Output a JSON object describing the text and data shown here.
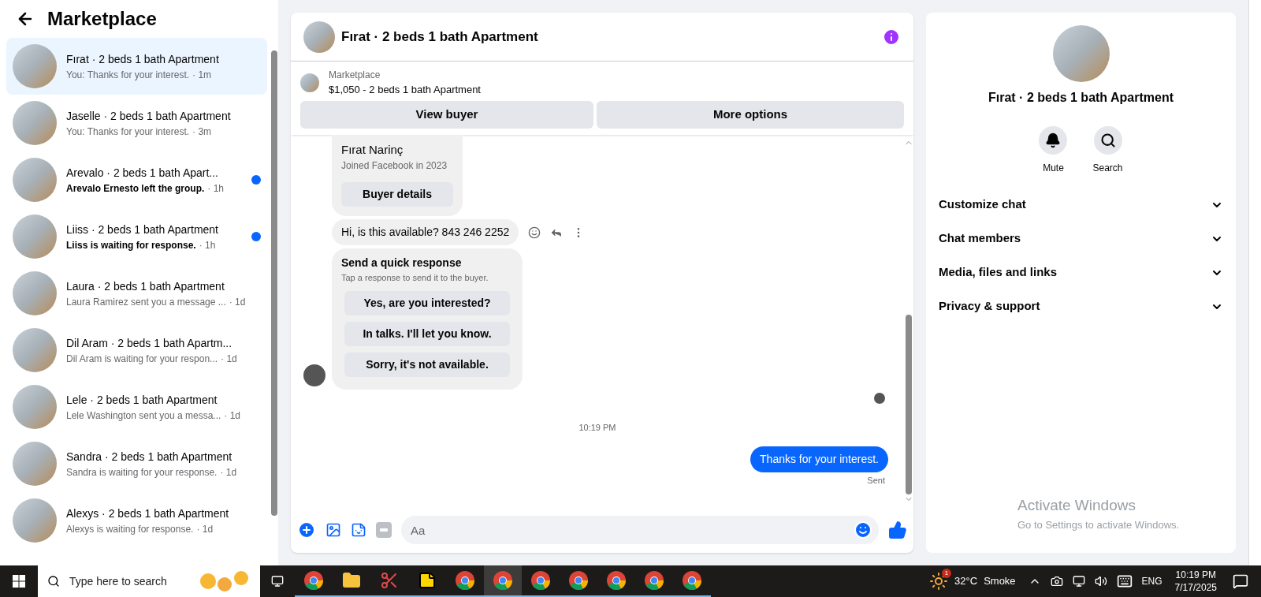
{
  "sidebar": {
    "title": "Marketplace",
    "conversations": [
      {
        "title": "Fırat · 2 beds 1 bath Apartment",
        "preview": "You: Thanks for your interest.",
        "time": "· 1m",
        "unread": false,
        "selected": true
      },
      {
        "title": "Jaselle · 2 beds 1 bath Apartment",
        "preview": "You: Thanks for your interest.",
        "time": "· 3m",
        "unread": false,
        "selected": false
      },
      {
        "title": "Arevalo · 2 beds 1 bath Apart...",
        "preview": "Arevalo Ernesto left the group.",
        "time": "· 1h",
        "unread": true,
        "selected": false
      },
      {
        "title": "Liiss · 2 beds 1 bath Apartment",
        "preview": "Liiss is waiting for response.",
        "time": "· 1h",
        "unread": true,
        "selected": false
      },
      {
        "title": "Laura · 2 beds 1 bath Apartment",
        "preview": "Laura Ramirez sent you a message ...",
        "time": "· 1d",
        "unread": false,
        "selected": false
      },
      {
        "title": "Dil Aram · 2 beds 1 bath Apartm...",
        "preview": "Dil Aram is waiting for your respon...",
        "time": "· 1d",
        "unread": false,
        "selected": false
      },
      {
        "title": "Lele · 2 beds 1 bath Apartment",
        "preview": "Lele Washington sent you a messa...",
        "time": "· 1d",
        "unread": false,
        "selected": false
      },
      {
        "title": "Sandra · 2 beds 1 bath Apartment",
        "preview": "Sandra is waiting for your response.",
        "time": "· 1d",
        "unread": false,
        "selected": false
      },
      {
        "title": "Alexys · 2 beds 1 bath Apartment",
        "preview": "Alexys is waiting for response.",
        "time": "· 1d",
        "unread": false,
        "selected": false
      }
    ]
  },
  "chat": {
    "title": "Fırat · 2 beds 1 bath Apartment",
    "listing": {
      "label": "Marketplace",
      "title": "$1,050 - 2 beds 1 bath Apartment",
      "buttons": [
        "View buyer",
        "More options"
      ]
    },
    "buyer_card": {
      "name": "Fırat Narinç",
      "subtitle": "Joined Facebook in 2023",
      "button": "Buyer details"
    },
    "incoming_message": "Hi, is this available? 843 246 2252",
    "quick_response": {
      "title": "Send a quick response",
      "subtitle": "Tap a response to send it to the buyer.",
      "options": [
        "Yes, are you interested?",
        "In talks. I'll let you know.",
        "Sorry, it's not available."
      ]
    },
    "timestamp": "10:19 PM",
    "outgoing_message": "Thanks for your interest.",
    "status": "Sent",
    "composer": {
      "placeholder": "Aa"
    }
  },
  "details": {
    "title": "Fırat · 2 beds 1 bath Apartment",
    "actions": [
      {
        "kind": "mute",
        "label": "Mute"
      },
      {
        "kind": "search",
        "label": "Search"
      }
    ],
    "sections": [
      {
        "label": "Customize chat",
        "expanded": false
      },
      {
        "label": "Chat members",
        "expanded": false
      },
      {
        "label": "Media, files and links",
        "expanded": false
      },
      {
        "label": "Privacy & support",
        "expanded": false
      }
    ]
  },
  "activation_notice": {
    "title": "Activate Windows",
    "text": "Go to Settings to activate Windows."
  },
  "taskbar": {
    "search_placeholder": "Type here to search",
    "apps": [
      {
        "kind": "browser",
        "selected": false
      },
      {
        "kind": "folder",
        "selected": false
      },
      {
        "kind": "snip",
        "selected": false
      },
      {
        "kind": "note",
        "selected": false
      },
      {
        "kind": "browser",
        "selected": false
      },
      {
        "kind": "browser",
        "selected": true
      },
      {
        "kind": "browser",
        "selected": false
      },
      {
        "kind": "browser",
        "selected": false
      },
      {
        "kind": "browser",
        "selected": false
      },
      {
        "kind": "browser",
        "selected": false
      },
      {
        "kind": "browser",
        "selected": false
      }
    ],
    "weather": {
      "badge": "1",
      "temperature": "32°C",
      "condition": "Smoke"
    },
    "language": "ENG",
    "time": "10:19 PM",
    "date": "7/17/2025"
  }
}
